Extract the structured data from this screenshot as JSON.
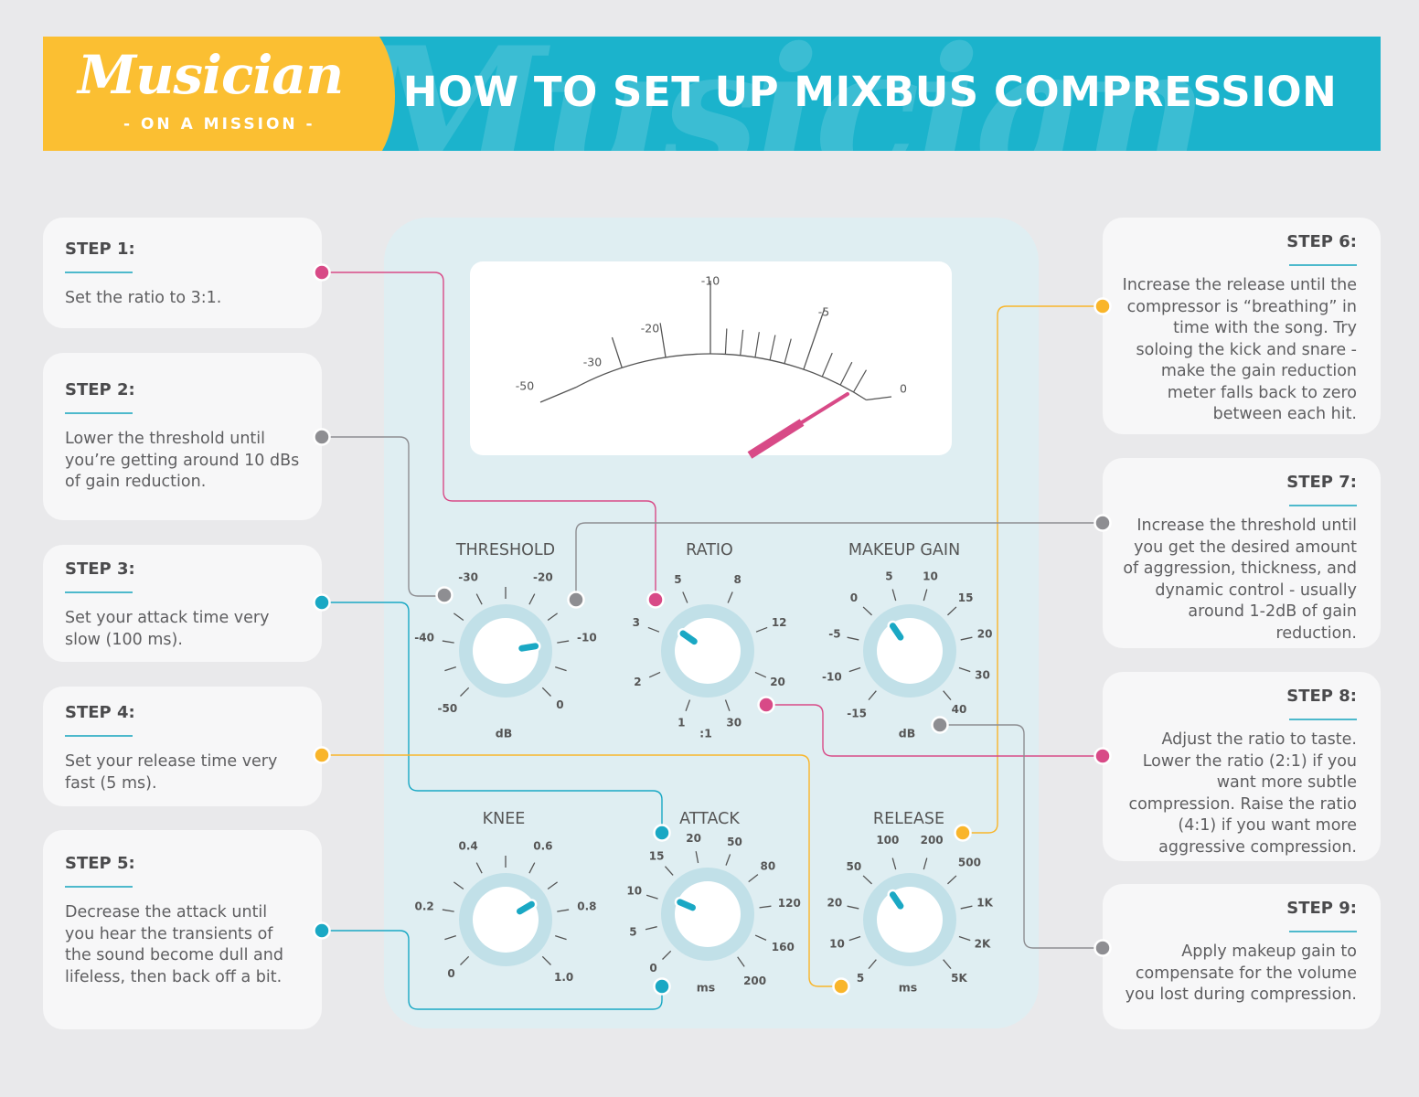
{
  "header": {
    "logo_main": "Musician",
    "logo_sub": "- ON A MISSION -",
    "watermark": "Musician",
    "title": "HOW TO SET UP MIXBUS COMPRESSION"
  },
  "colors": {
    "header_blue": "#1bb3cc",
    "logo_yellow": "#fbbf32",
    "pink": "#d84a87",
    "gray": "#8e8e92",
    "teal": "#1aa8c4",
    "yellow": "#f9b52a",
    "panel": "#dfeef2",
    "knob_ring": "#c1e0e8"
  },
  "steps": [
    {
      "label": "STEP 1:",
      "text": "Set the ratio to 3:1.",
      "color": "pink",
      "target": "ratio"
    },
    {
      "label": "STEP 2:",
      "text": "Lower the threshold until you’re getting around 10 dBs of gain reduction.",
      "color": "gray",
      "target": "threshold"
    },
    {
      "label": "STEP 3:",
      "text": "Set your attack time very slow (100 ms).",
      "color": "teal",
      "target": "attack"
    },
    {
      "label": "STEP 4:",
      "text": "Set your release time very fast (5 ms).",
      "color": "yellow",
      "target": "release"
    },
    {
      "label": "STEP 5:",
      "text": "Decrease the attack until you hear the transients of the sound become dull and lifeless, then back off a bit.",
      "color": "teal",
      "target": "attack"
    },
    {
      "label": "STEP 6:",
      "text": "Increase the release until the compressor is “breathing” in time with the song. Try soloing the kick and snare - make the gain reduction meter falls back to zero between each hit.",
      "color": "yellow",
      "target": "release"
    },
    {
      "label": "STEP 7:",
      "text": "Increase the threshold until you get the desired amount of aggression, thickness, and dynamic control - usually around 1-2dB of gain reduction.",
      "color": "gray",
      "target": "threshold"
    },
    {
      "label": "STEP 8:",
      "text": "Adjust the ratio to taste. Lower the ratio (2:1) if you want more subtle compression. Raise the ratio (4:1) if you want more aggressive compression.",
      "color": "pink",
      "target": "ratio"
    },
    {
      "label": "STEP 9:",
      "text": "Apply makeup gain to compensate for the volume you lost during compression.",
      "color": "gray",
      "target": "makeup_gain"
    }
  ],
  "meter": {
    "scale_labels": [
      "-50",
      "-30",
      "-20",
      "-10",
      "-5",
      "0"
    ],
    "needle_value": "-1"
  },
  "knobs": [
    {
      "id": "threshold",
      "name": "THRESHOLD",
      "unit": "dB",
      "ticks": [
        "-50",
        "",
        "-40",
        "",
        "-30",
        "",
        "-20",
        "",
        "-10",
        "",
        "0"
      ],
      "pointer_index": 8
    },
    {
      "id": "ratio",
      "name": "RATIO",
      "unit": ":1",
      "ticks": [
        "1",
        "2",
        "3",
        "5",
        "8",
        "12",
        "20",
        "30"
      ],
      "pointer_index": 2.3
    },
    {
      "id": "makeup_gain",
      "name": "MAKEUP GAIN",
      "unit": "dB",
      "ticks": [
        "-15",
        "-10",
        "-5",
        "0",
        "5",
        "10",
        "15",
        "20",
        "30",
        "40"
      ],
      "pointer_index": 3.4
    },
    {
      "id": "knee",
      "name": "KNEE",
      "unit": "",
      "ticks": [
        "0",
        "",
        "0.2",
        "",
        "0.4",
        "",
        "0.6",
        "",
        "0.8",
        "",
        "1.0"
      ],
      "pointer_index": 7.2
    },
    {
      "id": "attack",
      "name": "ATTACK",
      "unit": "ms",
      "ticks": [
        "0",
        "5",
        "10",
        "15",
        "20",
        "50",
        "80",
        "120",
        "160",
        "200"
      ],
      "pointer_index": 2.2
    },
    {
      "id": "release",
      "name": "RELEASE",
      "unit": "ms",
      "ticks": [
        "5",
        "10",
        "20",
        "50",
        "100",
        "200",
        "500",
        "1K",
        "2K",
        "5K"
      ],
      "pointer_index": 3.4
    }
  ]
}
